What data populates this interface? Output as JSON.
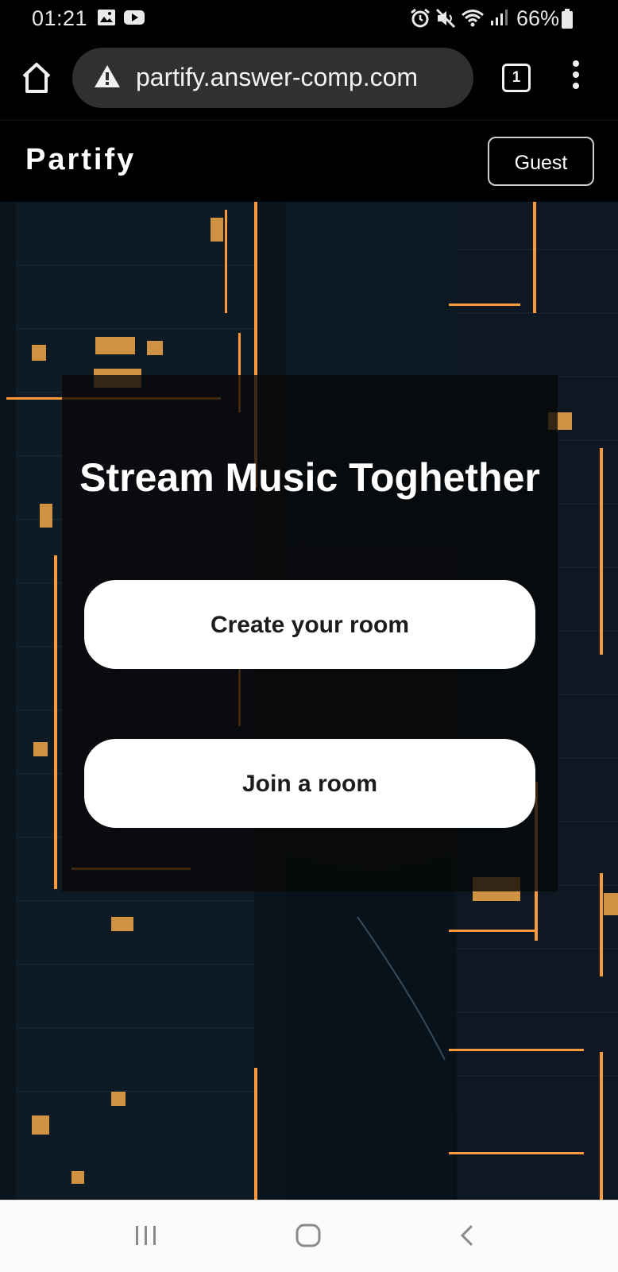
{
  "status_bar": {
    "time": "01:21",
    "battery_percent": "66%",
    "icons": [
      "gallery-icon",
      "youtube-icon",
      "alarm-icon",
      "mute-icon",
      "wifi-icon",
      "signal-icon",
      "battery-icon"
    ]
  },
  "browser": {
    "url": "partify.answer-comp.com",
    "tab_count": "1",
    "icons": [
      "home-icon",
      "warning-icon",
      "more-vert-icon"
    ]
  },
  "app": {
    "brand": "Partify",
    "user_button": "Guest"
  },
  "hero": {
    "headline": "Stream Music Toghether",
    "create_button": "Create your room",
    "join_button": "Join a room"
  },
  "nav": {
    "icons": [
      "recents-icon",
      "home-icon",
      "back-icon"
    ]
  },
  "colors": {
    "page_bg": "#000000",
    "urlbar_bg": "#303030",
    "card_bg": "#080808",
    "accent_light": "#ff9a3c",
    "button_bg": "#ffffff"
  }
}
